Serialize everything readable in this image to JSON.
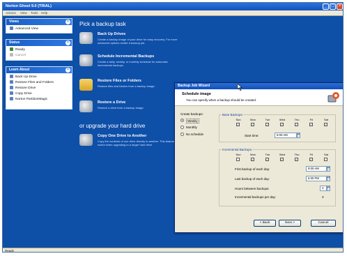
{
  "window": {
    "title": "Norton Ghost 9.0 (TRIAL)"
  },
  "menu": [
    "Actions",
    "View",
    "Tools",
    "Help"
  ],
  "left": {
    "views": {
      "title": "Views",
      "items": [
        "Advanced View"
      ]
    },
    "status": {
      "title": "Status",
      "items": [
        "Ready",
        "Cancel"
      ]
    },
    "learn": {
      "title": "Learn About",
      "items": [
        "Back Up Drive",
        "Restore Files and Folders",
        "Restore Drive",
        "Copy Drive",
        "Norton PartitionMagic"
      ]
    }
  },
  "main": {
    "heading": "Pick a backup task",
    "tasks": [
      {
        "title": "Back Up Drives",
        "desc": "Create a backup image of your drive for easy recovery. For more advanced options create a backup job."
      },
      {
        "title": "Schedule Incremental Backups",
        "desc": "Create a daily, weekly, or monthly schedule for automatic incremental backups."
      },
      {
        "title": "Restore Files or Folders",
        "desc": "Restore files and folders from a backup image."
      },
      {
        "title": "Restore a Drive",
        "desc": "Restore a drive from a backup image."
      }
    ],
    "upgrade_heading": "or upgrade your hard drive",
    "copy_task": {
      "title": "Copy One Drive to Another",
      "desc": "Copy the contents of one drive directly to another. This feature is useful when upgrading to a larger hard drive."
    }
  },
  "statusbar": {
    "text": "Ready"
  },
  "wizard": {
    "title": "Backup Job Wizard",
    "header_title": "Schedule image",
    "header_sub": "You can specify when a backup should be created.",
    "create_label": "Create backups:",
    "options": [
      "Weekly",
      "Monthly",
      "No schedule"
    ],
    "selected_option": "Weekly",
    "base_group": "Base Backups",
    "days": [
      "Sun",
      "Mon",
      "Tue",
      "Wed",
      "Thu",
      "Fri",
      "Sat"
    ],
    "start_time_label": "Start time:",
    "start_time": "6:00 AM",
    "inc_group": "Incremental Backups",
    "first_label": "First backup of each day:",
    "first_value": "9:00 AM",
    "last_label": "Last backup of each day:",
    "last_value": "5:00 PM",
    "hours_label": "Hours between backups:",
    "hours_value": "3",
    "per_day_label": "Incremental backups per day:",
    "per_day_value": "3",
    "buttons": {
      "back": "< Back",
      "next": "Next >",
      "cancel": "Cancel"
    }
  }
}
